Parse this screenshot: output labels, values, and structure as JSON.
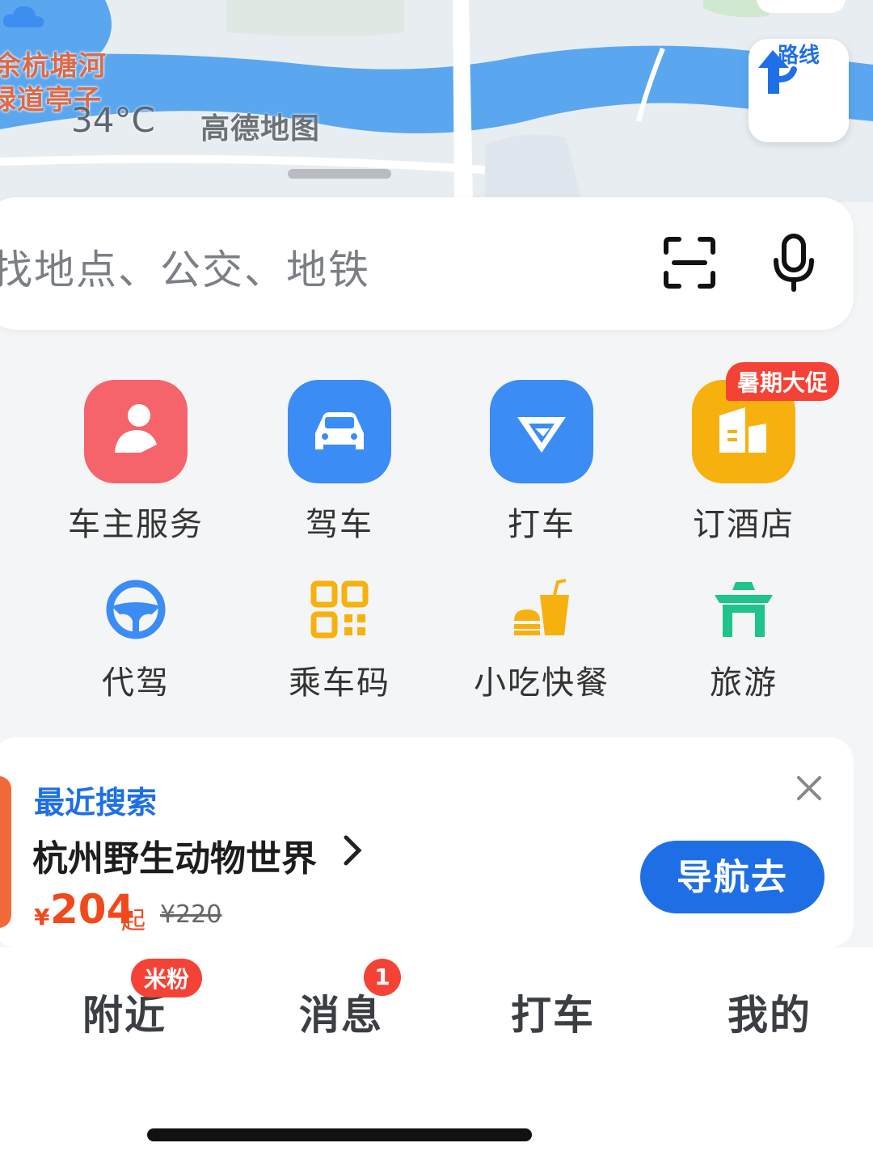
{
  "map": {
    "label_line1": "余杭塘河",
    "label_line2": "绿道亭子",
    "temperature": "34°C",
    "weather_icon": "cloud-icon",
    "brand": "高德地图",
    "route_label": "路线"
  },
  "search": {
    "placeholder": "找地点、公交、地铁",
    "scan_icon": "scan-icon",
    "mic_icon": "microphone-icon"
  },
  "services": [
    {
      "label": "车主服务",
      "color": "#f5646b"
    },
    {
      "label": "驾车",
      "color": "#3b8cf5"
    },
    {
      "label": "打车",
      "color": "#3b8cf5"
    },
    {
      "label": "订酒店",
      "color": "#f7b10f",
      "badge": "暑期大促"
    },
    {
      "label": "代驾",
      "color": "#3b8cf5"
    },
    {
      "label": "乘车码",
      "color": "#f7b10f"
    },
    {
      "label": "小吃快餐",
      "color": "#f7b10f"
    },
    {
      "label": "旅游",
      "color": "#1ec48a"
    }
  ],
  "recent": {
    "title": "最近搜索",
    "place": "杭州野生动物世界",
    "currency": "¥",
    "price": "204",
    "price_suffix": "起",
    "original_price": "¥220",
    "navigate_label": "导航去"
  },
  "tabs": [
    {
      "label": "附近",
      "badge": "米粉"
    },
    {
      "label": "消息",
      "badge": "1"
    },
    {
      "label": "打车"
    },
    {
      "label": "我的"
    }
  ],
  "colors": {
    "accent": "#1e6fe6",
    "badge": "#f44336",
    "price": "#f04a1c"
  }
}
